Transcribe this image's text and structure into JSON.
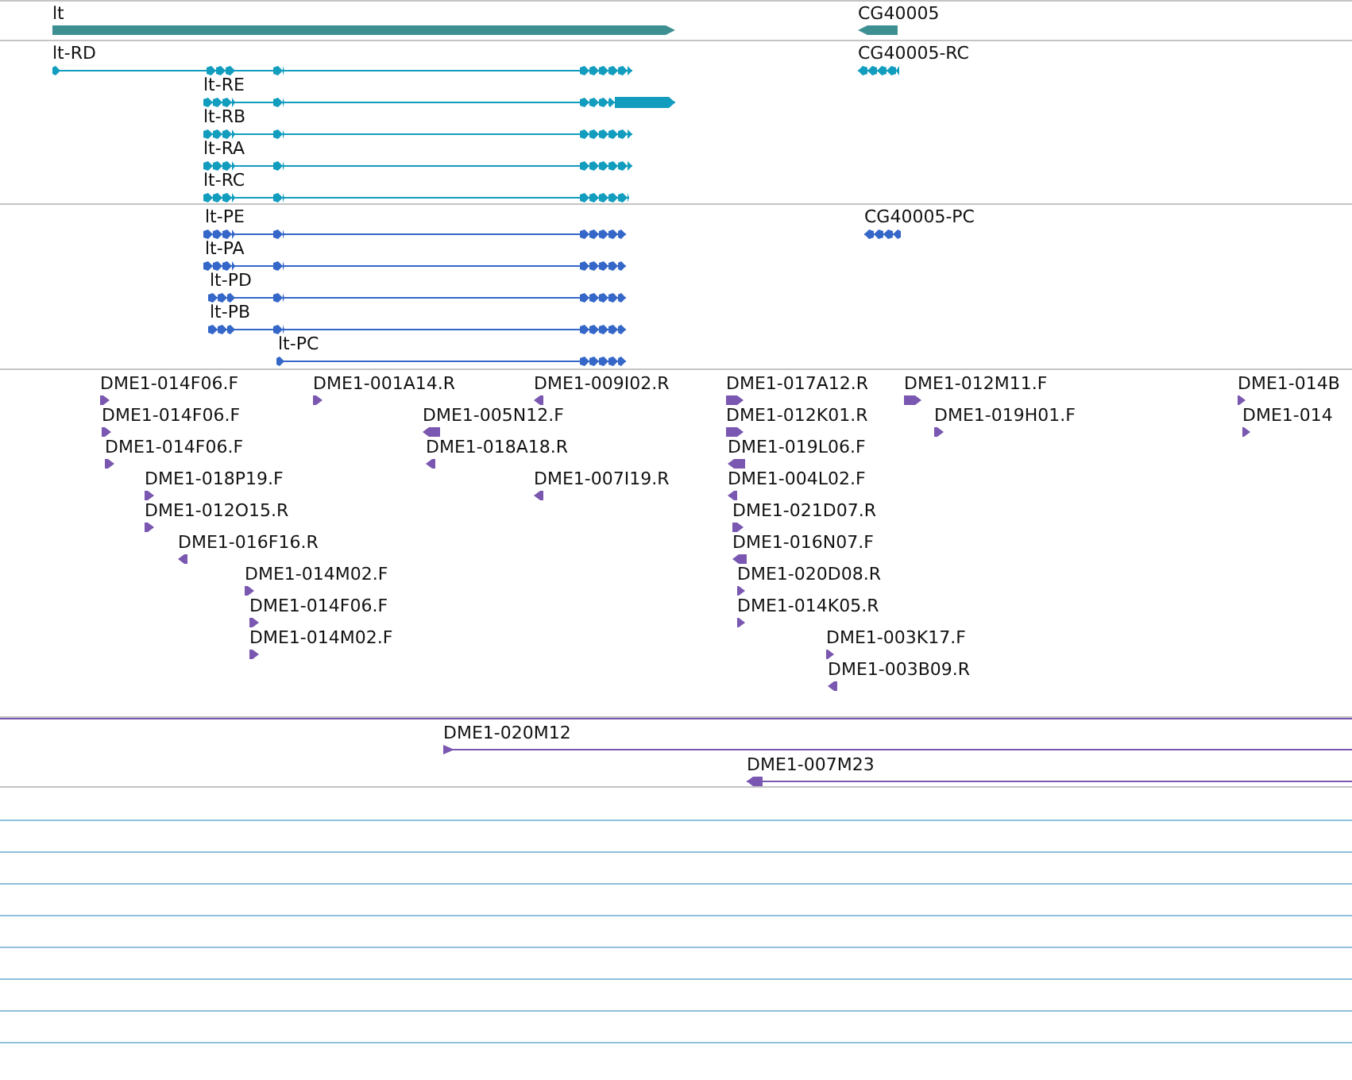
{
  "genes": [
    {
      "label": "lt",
      "reverse": false
    },
    {
      "label": "CG40005",
      "reverse": true
    }
  ],
  "transcripts": [
    {
      "label": "lt-RD",
      "reverse": false
    },
    {
      "label": "lt-RE",
      "reverse": false
    },
    {
      "label": "lt-RB",
      "reverse": false
    },
    {
      "label": "lt-RA",
      "reverse": false
    },
    {
      "label": "lt-RC",
      "reverse": false
    },
    {
      "label": "CG40005-RC",
      "reverse": true
    }
  ],
  "proteins": [
    {
      "label": "lt-PE",
      "reverse": false
    },
    {
      "label": "lt-PA",
      "reverse": false
    },
    {
      "label": "lt-PD",
      "reverse": false
    },
    {
      "label": "lt-PB",
      "reverse": false
    },
    {
      "label": "lt-PC",
      "reverse": false
    },
    {
      "label": "CG40005-PC",
      "reverse": true
    }
  ],
  "ests": [
    {
      "label": "DME1-014F06.F",
      "reverse": false
    },
    {
      "label": "DME1-001A14.R",
      "reverse": false
    },
    {
      "label": "DME1-009I02.R",
      "reverse": true
    },
    {
      "label": "DME1-017A12.R",
      "reverse": false
    },
    {
      "label": "DME1-012M11.F",
      "reverse": false
    },
    {
      "label": "DME1-014B",
      "reverse": false
    },
    {
      "label": "DME1-014F06.F",
      "reverse": false
    },
    {
      "label": "DME1-005N12.F",
      "reverse": true
    },
    {
      "label": "DME1-012K01.R",
      "reverse": false
    },
    {
      "label": "DME1-019H01.F",
      "reverse": false
    },
    {
      "label": "DME1-014",
      "reverse": false
    },
    {
      "label": "DME1-014F06.F",
      "reverse": false
    },
    {
      "label": "DME1-018A18.R",
      "reverse": true
    },
    {
      "label": "DME1-019L06.F",
      "reverse": true
    },
    {
      "label": "DME1-018P19.F",
      "reverse": false
    },
    {
      "label": "DME1-007I19.R",
      "reverse": true
    },
    {
      "label": "DME1-004L02.F",
      "reverse": true
    },
    {
      "label": "DME1-012O15.R",
      "reverse": false
    },
    {
      "label": "DME1-021D07.R",
      "reverse": false
    },
    {
      "label": "DME1-016F16.R",
      "reverse": true
    },
    {
      "label": "DME1-016N07.F",
      "reverse": true
    },
    {
      "label": "DME1-014M02.F",
      "reverse": false
    },
    {
      "label": "DME1-020D08.R",
      "reverse": false
    },
    {
      "label": "DME1-014F06.F",
      "reverse": false
    },
    {
      "label": "DME1-014K05.R",
      "reverse": false
    },
    {
      "label": "DME1-014M02.F",
      "reverse": false
    },
    {
      "label": "DME1-003K17.F",
      "reverse": false
    },
    {
      "label": "DME1-003B09.R",
      "reverse": true
    }
  ],
  "clones": [
    {
      "label": "DME1-020M12",
      "reverse": false
    },
    {
      "label": "DME1-007M23",
      "reverse": true
    }
  ]
}
